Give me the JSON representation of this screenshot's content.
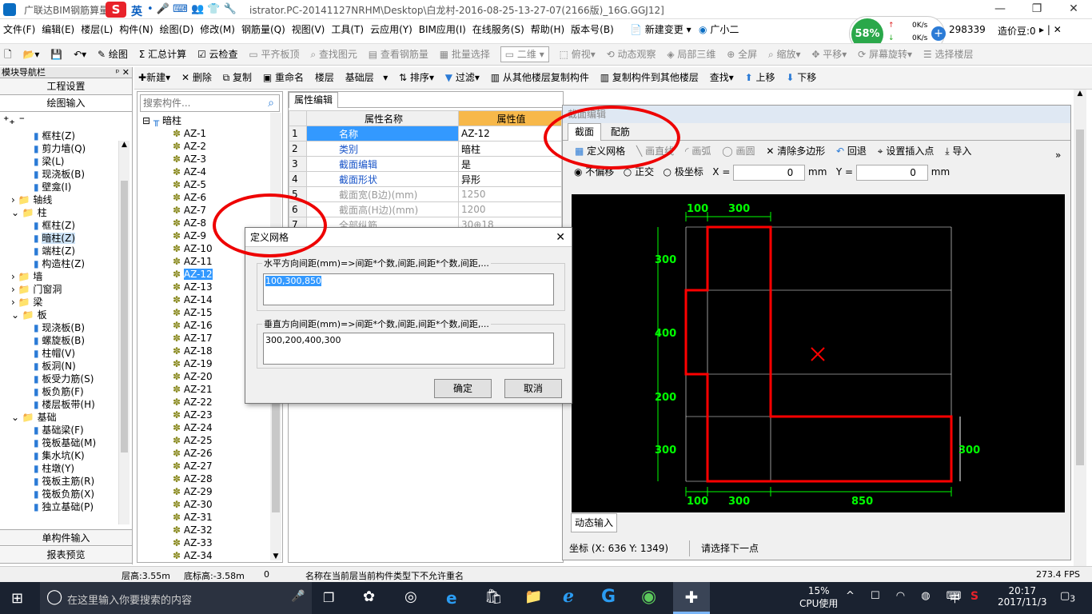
{
  "window": {
    "title_prefix": "广联达BIM钢筋算量",
    "title_suffix": "istrator.PC-20141127NRHM\\Desktop\\白龙村-2016-08-25-13-27-07(2166版)_16G.GGJ12]",
    "ime_label": "英"
  },
  "menu": [
    "文件(F)",
    "编辑(E)",
    "楼层(L)",
    "构件(N)",
    "绘图(D)",
    "修改(M)",
    "钢筋量(Q)",
    "视图(V)",
    "工具(T)",
    "云应用(Y)",
    "BIM应用(I)",
    "在线服务(S)",
    "帮助(H)",
    "版本号(B)"
  ],
  "menu_extra": {
    "new_change": "新建变更",
    "assistant": "广小二",
    "account": "298339",
    "price_beans": "造价豆:0"
  },
  "net_widget": {
    "percent": "58%",
    "up": "0K/s",
    "down": "0K/s"
  },
  "toolbar1": {
    "draw": "绘图",
    "sum": "汇总计算",
    "cloud_check": "云检查",
    "flat_board": "平齐板顶",
    "find_elem": "查找图元",
    "view_rebar": "查看钢筋量",
    "batch_select": "批量选择",
    "view_mode": "二维",
    "top_view": "俯视",
    "dynamic": "动态观察",
    "local_3d": "局部三维",
    "fullscreen": "全屏",
    "zoom": "缩放",
    "pan": "平移",
    "rotate": "屏幕旋转",
    "select_floor": "选择楼层"
  },
  "toolbar2": {
    "new": "新建",
    "delete": "删除",
    "copy": "复制",
    "rename": "重命名",
    "floor_label": "楼层",
    "floor_value": "基础层",
    "sort": "排序",
    "filter": "过滤",
    "copy_from": "从其他楼层复制构件",
    "copy_to": "复制构件到其他楼层",
    "find": "查找",
    "up": "上移",
    "down": "下移"
  },
  "nav": {
    "header": "模块导航栏",
    "btn_settings": "工程设置",
    "btn_draw": "绘图输入",
    "btn_single": "单构件输入",
    "btn_report": "报表预览",
    "tree": [
      {
        "label": "框柱(Z)",
        "indent": 3
      },
      {
        "label": "剪力墙(Q)",
        "indent": 3
      },
      {
        "label": "梁(L)",
        "indent": 3
      },
      {
        "label": "现浇板(B)",
        "indent": 3
      },
      {
        "label": "壁龛(I)",
        "indent": 3
      },
      {
        "label": "轴线",
        "indent": 1,
        "folder": true,
        "exp": "+"
      },
      {
        "label": "柱",
        "indent": 1,
        "folder": true,
        "exp": "-"
      },
      {
        "label": "框柱(Z)",
        "indent": 3
      },
      {
        "label": "暗柱(Z)",
        "indent": 3,
        "sel": true
      },
      {
        "label": "端柱(Z)",
        "indent": 3
      },
      {
        "label": "构造柱(Z)",
        "indent": 3
      },
      {
        "label": "墙",
        "indent": 1,
        "folder": true,
        "exp": "+"
      },
      {
        "label": "门窗洞",
        "indent": 1,
        "folder": true,
        "exp": "+"
      },
      {
        "label": "梁",
        "indent": 1,
        "folder": true,
        "exp": "+"
      },
      {
        "label": "板",
        "indent": 1,
        "folder": true,
        "exp": "-"
      },
      {
        "label": "现浇板(B)",
        "indent": 3
      },
      {
        "label": "螺旋板(B)",
        "indent": 3
      },
      {
        "label": "柱帽(V)",
        "indent": 3
      },
      {
        "label": "板洞(N)",
        "indent": 3
      },
      {
        "label": "板受力筋(S)",
        "indent": 3
      },
      {
        "label": "板负筋(F)",
        "indent": 3
      },
      {
        "label": "楼层板带(H)",
        "indent": 3
      },
      {
        "label": "基础",
        "indent": 1,
        "folder": true,
        "exp": "-"
      },
      {
        "label": "基础梁(F)",
        "indent": 3
      },
      {
        "label": "筏板基础(M)",
        "indent": 3
      },
      {
        "label": "集水坑(K)",
        "indent": 3
      },
      {
        "label": "柱墩(Y)",
        "indent": 3
      },
      {
        "label": "筏板主筋(R)",
        "indent": 3
      },
      {
        "label": "筏板负筋(X)",
        "indent": 3
      },
      {
        "label": "独立基础(P)",
        "indent": 3
      }
    ]
  },
  "components": {
    "search_placeholder": "搜索构件...",
    "root": "暗柱",
    "items": [
      "AZ-1",
      "AZ-2",
      "AZ-3",
      "AZ-4",
      "AZ-5",
      "AZ-6",
      "AZ-7",
      "AZ-8",
      "AZ-9",
      "AZ-10",
      "AZ-11",
      "AZ-12",
      "AZ-13",
      "AZ-14",
      "AZ-15",
      "AZ-16",
      "AZ-17",
      "AZ-18",
      "AZ-19",
      "AZ-20",
      "AZ-21",
      "AZ-22",
      "AZ-23",
      "AZ-24",
      "AZ-25",
      "AZ-26",
      "AZ-27",
      "AZ-28",
      "AZ-29",
      "AZ-30",
      "AZ-31",
      "AZ-32",
      "AZ-33",
      "AZ-34"
    ],
    "selected": "AZ-12"
  },
  "props": {
    "tab": "属性编辑",
    "col_name": "属性名称",
    "col_value": "属性值",
    "rows": [
      {
        "n": "1",
        "name": "名称",
        "value": "AZ-12",
        "blue": true
      },
      {
        "n": "2",
        "name": "类别",
        "value": "暗柱",
        "blue": true
      },
      {
        "n": "3",
        "name": "截面编辑",
        "value": "是",
        "blue": true
      },
      {
        "n": "4",
        "name": "截面形状",
        "value": "异形",
        "blue": true
      },
      {
        "n": "5",
        "name": "截面宽(B边)(mm)",
        "value": "1250",
        "blue": false
      },
      {
        "n": "6",
        "name": "截面高(H边)(mm)",
        "value": "1200",
        "blue": false
      },
      {
        "n": "7",
        "name": "全部纵筋",
        "value": "30⊕18",
        "blue": false
      }
    ]
  },
  "section_editor": {
    "title": "截面编辑",
    "tab_section": "截面",
    "tab_rebar": "配筋",
    "tools": {
      "define_grid": "定义网格",
      "line": "画直线",
      "arc": "画弧",
      "circle": "画圆",
      "clear_poly": "清除多边形",
      "undo": "回退",
      "insert_point": "设置插入点",
      "import": "导入"
    },
    "offset": {
      "no_offset": "不偏移",
      "ortho": "正交",
      "polar": "极坐标",
      "x_label": "X =",
      "y_label": "Y =",
      "x_val": "0",
      "y_val": "0",
      "unit": "mm"
    },
    "dim_top": [
      "100",
      "300"
    ],
    "dim_left": [
      "300",
      "400",
      "200",
      "300"
    ],
    "dim_bottom": [
      "100",
      "300",
      "850"
    ],
    "dim_right": "300",
    "dynamic_input": "动态输入",
    "coord": "坐标 (X: 636 Y: 1349)",
    "hint": "请选择下一点"
  },
  "dialog": {
    "title": "定义网格",
    "h_label": "水平方向间距(mm)=>间距*个数,间距,间距*个数,间距,...",
    "h_value": "100,300,850",
    "v_label": "垂直方向间距(mm)=>间距*个数,间距,间距*个数,间距,...",
    "v_value": "300,200,400,300",
    "ok": "确定",
    "cancel": "取消"
  },
  "status": {
    "floor_height": "层高:3.55m",
    "bottom_height": "底标高:-3.58m",
    "zero": "0",
    "message": "名称在当前层当前构件类型下不允许重名",
    "fps": "273.4 FPS"
  },
  "taskbar": {
    "search": "在这里输入你要搜索的内容",
    "cpu_pct": "15%",
    "cpu_label": "CPU使用",
    "ime": "中",
    "time": "20:17",
    "date": "2017/11/3",
    "notif": "3"
  }
}
